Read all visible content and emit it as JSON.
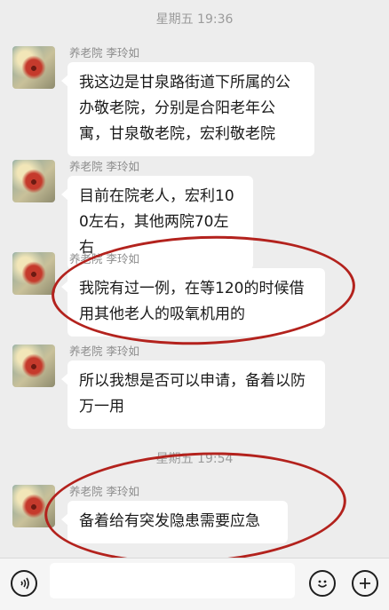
{
  "timestamps": [
    "星期五 19:36",
    "星期五 19:54"
  ],
  "messages": [
    {
      "sender": "养老院  李玲如",
      "text": "我这边是甘泉路街道下所属的公办敬老院，分别是合阳老年公寓，甘泉敬老院，宏利敬老院"
    },
    {
      "sender": "养老院  李玲如",
      "text": "目前在院老人，宏利100左右，其他两院70左右"
    },
    {
      "sender": "养老院  李玲如",
      "text": "我院有过一例，在等120的时候借用其他老人的吸氧机用的"
    },
    {
      "sender": "养老院  李玲如",
      "text": "所以我想是否可以申请，备着以防万一用"
    },
    {
      "sender": "养老院  李玲如",
      "text": "备着给有突发隐患需要应急"
    }
  ],
  "input_bar": {
    "voice_icon": "voice-icon",
    "emoji_icon": "emoji-icon",
    "plus_icon": "plus-icon",
    "input_value": ""
  },
  "colors": {
    "background": "#ededed",
    "bubble": "#ffffff",
    "annotation_red": "#b3221d",
    "timestamp": "#9b9b9b"
  }
}
